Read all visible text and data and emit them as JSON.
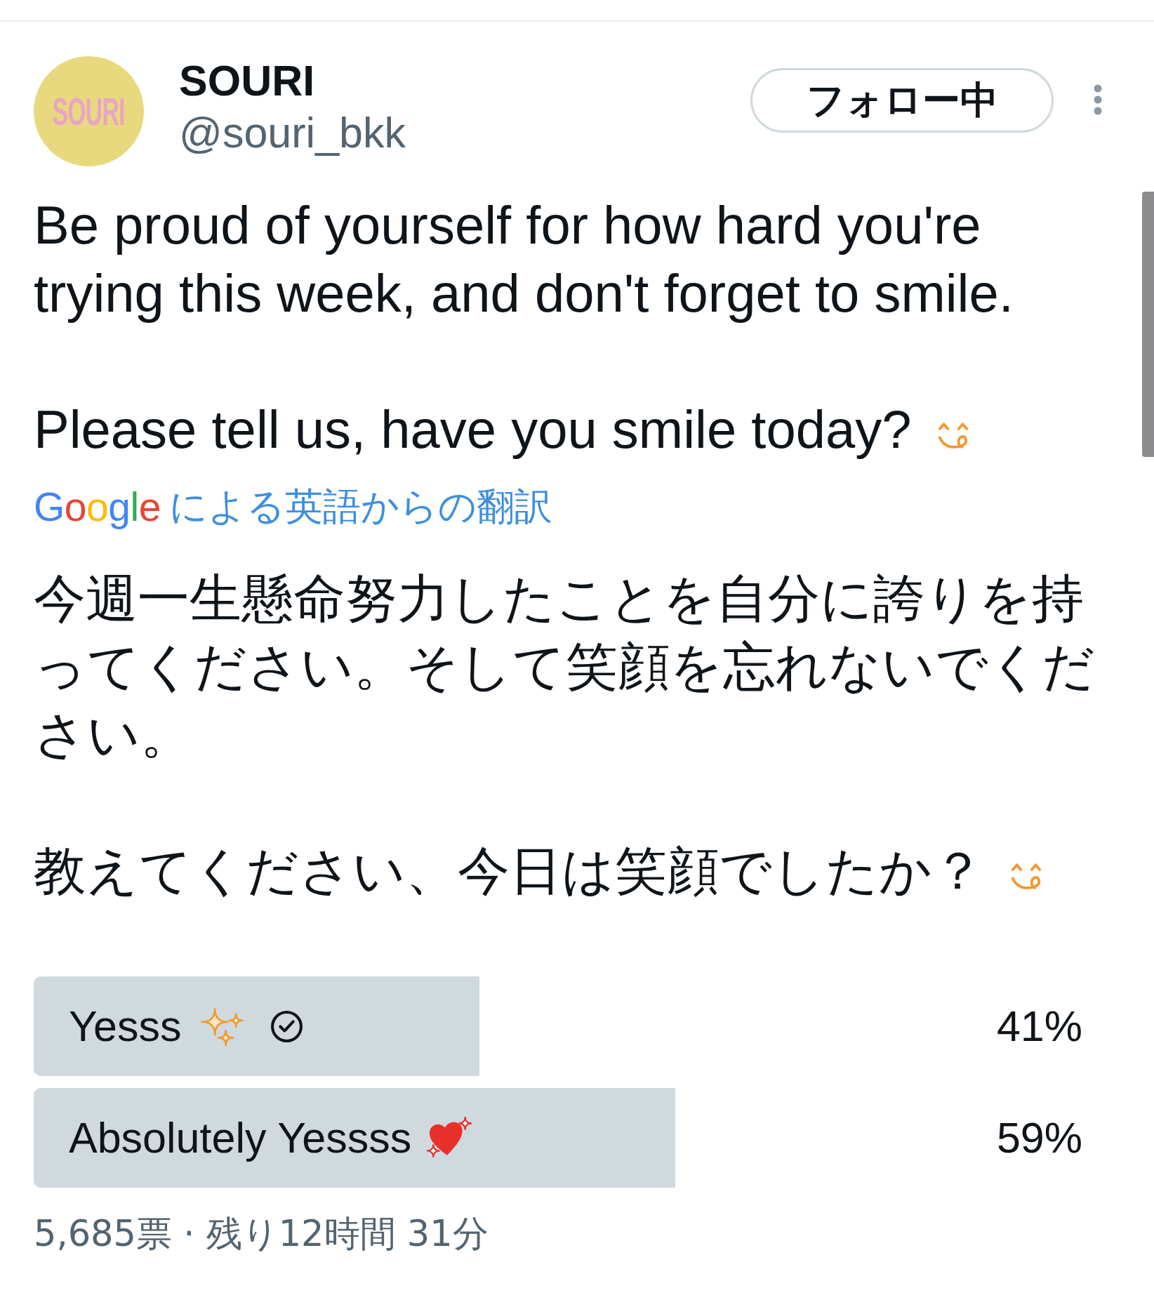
{
  "header": {
    "avatar": {
      "text": "SOURI"
    },
    "name": "SOURI",
    "handle": "@souri_bkk",
    "follow_button": {
      "label": "フォロー中",
      "following": true
    }
  },
  "post": {
    "paragraphs": [
      "Be proud of yourself for how hard you're trying this week, and don't forget to smile.",
      "Please tell us, have you smile today?"
    ],
    "translation": {
      "logo": "Google",
      "label": "による英語からの翻訳"
    },
    "translated_paragraphs": [
      "今週一生懸命努力したことを自分に誇りを持ってください。そして笑顔を忘れないでください。",
      "教えてください、今日は笑顔でしたか？"
    ]
  },
  "poll": {
    "options": [
      {
        "label": "Yesss",
        "voted": true,
        "level": 0.41,
        "percent": "41%"
      },
      {
        "label": "Absolutely Yessss",
        "voted": false,
        "level": 0.59,
        "percent": "59%"
      }
    ],
    "footer": "5,685票 · 残り12時間 31分"
  }
}
